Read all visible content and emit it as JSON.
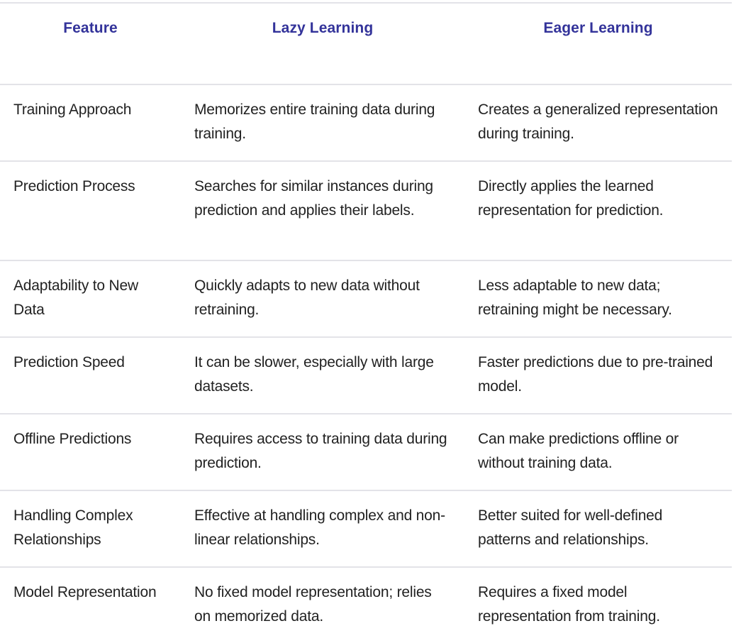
{
  "table": {
    "headers": [
      "Feature",
      "Lazy Learning",
      "Eager Learning"
    ],
    "rows": [
      {
        "feature": "Training Approach",
        "lazy": "Memorizes entire training data during training.",
        "eager": "Creates a generalized representation during training."
      },
      {
        "feature": "Prediction Process",
        "lazy": "Searches for similar instances during prediction and applies their labels.",
        "eager": "Directly applies the learned representation for prediction."
      },
      {
        "feature": "Adaptability to New Data",
        "lazy": "Quickly adapts to new data without retraining.",
        "eager": "Less adaptable to new data; retraining might be necessary."
      },
      {
        "feature": "Prediction Speed",
        "lazy": "It can be slower, especially with large datasets.",
        "eager": "Faster predictions due to pre-trained model."
      },
      {
        "feature": "Offline Predictions",
        "lazy": "Requires access to training data during prediction.",
        "eager": "Can make predictions offline or without training data."
      },
      {
        "feature": "Handling Complex Relationships",
        "lazy": "Effective at handling complex and non-linear relationships.",
        "eager": "Better suited for well-defined patterns and relationships."
      },
      {
        "feature": "Model Representation",
        "lazy": "No fixed model representation; relies on memorized data.",
        "eager": "Requires a fixed model representation from training."
      }
    ]
  },
  "colors": {
    "header_text": "#33339a",
    "body_text": "#222222",
    "divider": "#e3e3e8"
  }
}
